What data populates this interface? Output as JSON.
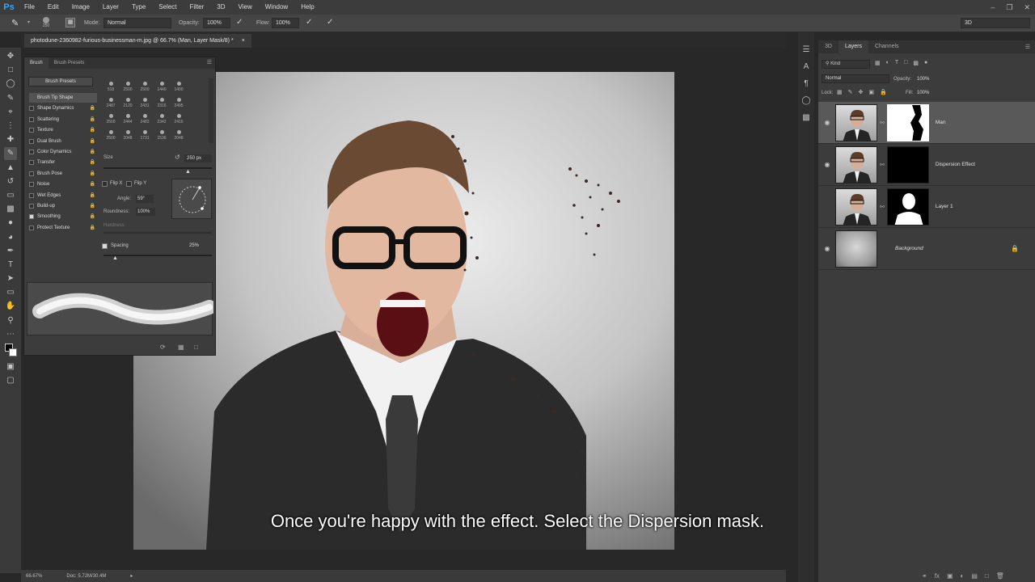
{
  "app": {
    "logo": "Ps"
  },
  "menu": [
    "File",
    "Edit",
    "Image",
    "Layer",
    "Type",
    "Select",
    "Filter",
    "3D",
    "View",
    "Window",
    "Help"
  ],
  "options": {
    "brush_size": "250",
    "mode_label": "Mode:",
    "mode_value": "Normal",
    "opacity_label": "Opacity:",
    "opacity_value": "100%",
    "flow_label": "Flow:",
    "flow_value": "100%",
    "workspace": "3D"
  },
  "document": {
    "tab_title": "photodune-2360982-furious-businessman-m.jpg @ 66.7% (Man, Layer Mask/8) *",
    "close_glyph": "×",
    "zoom": "66.67%",
    "doc_info": "Doc: 5.72M/30.4M"
  },
  "subtitle": "Once you're happy with the effect. Select the Dispersion mask.",
  "brush_panel": {
    "tabs": [
      "Brush",
      "Brush Presets"
    ],
    "presets_button": "Brush Presets",
    "options": [
      {
        "label": "Brush Tip Shape",
        "checkbox": false,
        "checked": false,
        "lock": false,
        "active": true
      },
      {
        "label": "Shape Dynamics",
        "checkbox": true,
        "checked": false,
        "lock": true
      },
      {
        "label": "Scattering",
        "checkbox": true,
        "checked": false,
        "lock": true
      },
      {
        "label": "Texture",
        "checkbox": true,
        "checked": false,
        "lock": true
      },
      {
        "label": "Dual Brush",
        "checkbox": true,
        "checked": false,
        "lock": true
      },
      {
        "label": "Color Dynamics",
        "checkbox": true,
        "checked": false,
        "lock": true
      },
      {
        "label": "Transfer",
        "checkbox": true,
        "checked": false,
        "lock": true
      },
      {
        "label": "Brush Pose",
        "checkbox": true,
        "checked": false,
        "lock": true
      },
      {
        "label": "Noise",
        "checkbox": true,
        "checked": false,
        "lock": true
      },
      {
        "label": "Wet Edges",
        "checkbox": true,
        "checked": false,
        "lock": true
      },
      {
        "label": "Build-up",
        "checkbox": true,
        "checked": false,
        "lock": true
      },
      {
        "label": "Smoothing",
        "checkbox": true,
        "checked": true,
        "lock": true
      },
      {
        "label": "Protect Texture",
        "checkbox": true,
        "checked": false,
        "lock": true
      }
    ],
    "tips": [
      "518",
      "2500",
      "2500",
      "1440",
      "1400",
      "2487",
      "2120",
      "2431",
      "2316",
      "2495",
      "2500",
      "2444",
      "2483",
      "2342",
      "2416",
      "2500",
      "2048",
      "1731",
      "1536",
      "2048"
    ],
    "size_label": "Size",
    "size_value": "250 px",
    "flip_x": "Flip X",
    "flip_y": "Flip Y",
    "angle_label": "Angle:",
    "angle_value": "59°",
    "roundness_label": "Roundness:",
    "roundness_value": "100%",
    "hardness_label": "Hardness",
    "spacing_label": "Spacing",
    "spacing_value": "25%"
  },
  "layers_panel": {
    "tabs": [
      "3D",
      "Layers",
      "Channels"
    ],
    "kind_label": "Kind",
    "blend_mode": "Normal",
    "opacity_label": "Opacity:",
    "opacity_value": "100%",
    "lock_label": "Lock:",
    "fill_label": "Fill:",
    "fill_value": "100%",
    "layers": [
      {
        "name": "Man",
        "visible": true,
        "selected": true,
        "mask": "man"
      },
      {
        "name": "Dispersion Effect",
        "visible": true,
        "selected": false,
        "mask": "black"
      },
      {
        "name": "Layer 1",
        "visible": false,
        "selected": false,
        "mask": "silhouette"
      },
      {
        "name": "Background",
        "visible": true,
        "selected": false,
        "mask": "none",
        "locked": true
      }
    ]
  }
}
